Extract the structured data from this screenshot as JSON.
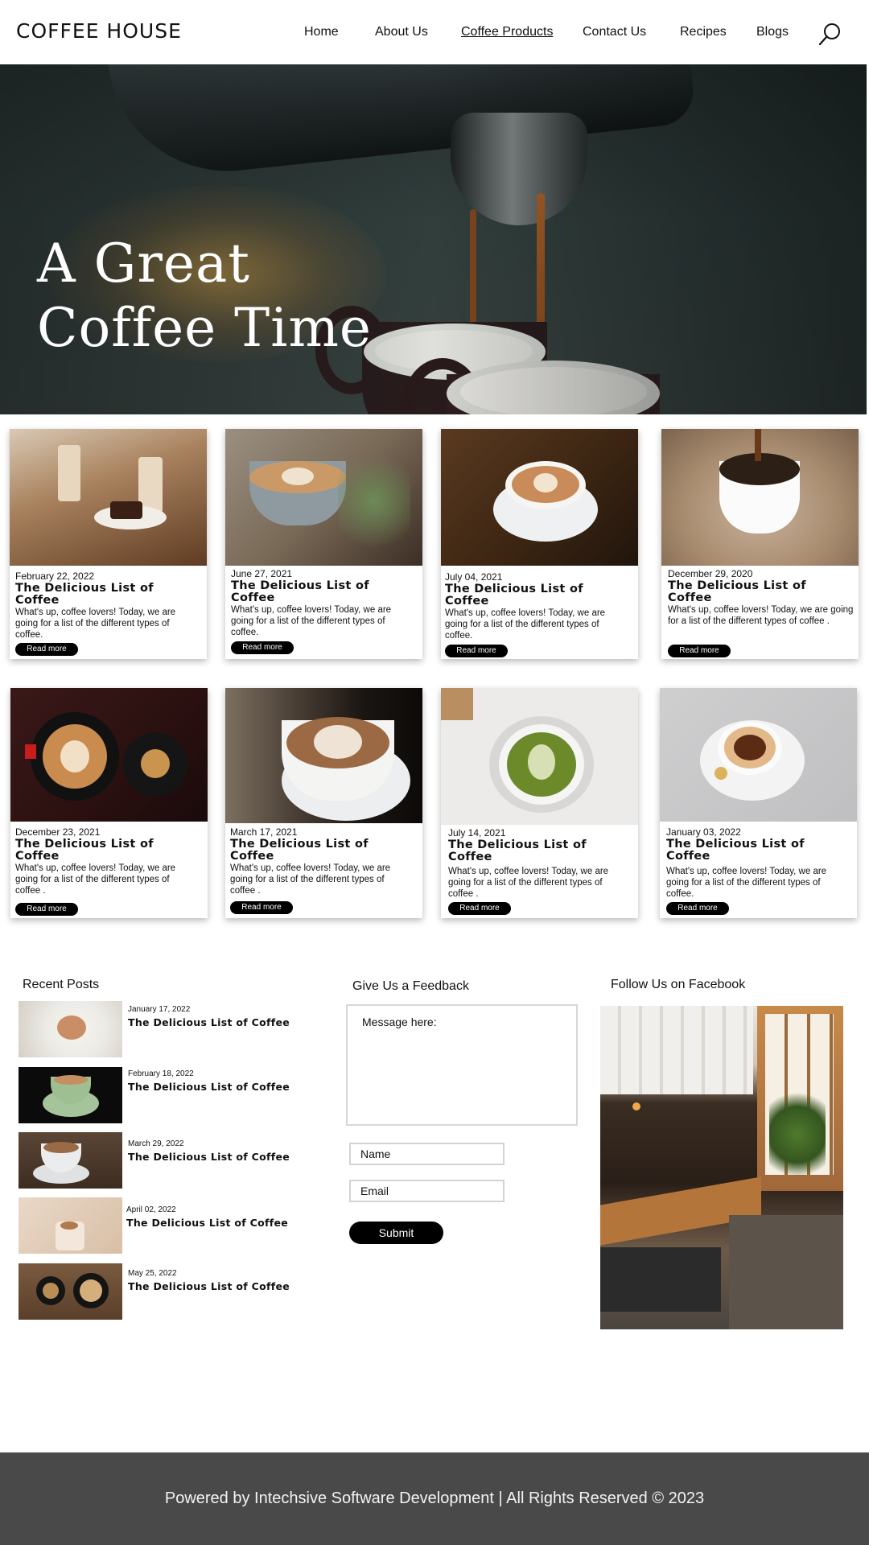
{
  "header": {
    "logo": "COFFEE HOUSE",
    "nav": [
      {
        "label": "Home"
      },
      {
        "label": "About Us"
      },
      {
        "label": "Coffee Products",
        "active": true
      },
      {
        "label": "Contact Us"
      },
      {
        "label": "Recipes"
      },
      {
        "label": "Blogs"
      }
    ],
    "search_icon": "search-icon"
  },
  "hero": {
    "title_line1": "A Great",
    "title_line2": "Coffee Time"
  },
  "cards": [
    {
      "date": "February 22, 2022",
      "title": "The Delicious List of Coffee",
      "text": "What's up, coffee lovers! Today, we are going for a list of the different types of coffee.",
      "button": "Read more"
    },
    {
      "date": "June 27, 2021",
      "title": "The Delicious List of Coffee",
      "text": "What's up, coffee lovers! Today, we are going for a list of the different types of coffee.",
      "button": "Read more"
    },
    {
      "date": "July 04, 2021",
      "title": "The Delicious List of Coffee",
      "text": "What's up, coffee lovers! Today, we are going for a list of the different types of coffee.",
      "button": "Read more"
    },
    {
      "date": "December 29, 2020",
      "title": "The Delicious List of Coffee",
      "text": "What's up, coffee lovers! Today, we are going for a list of the different types of coffee .",
      "button": "Read more"
    },
    {
      "date": "December 23, 2021",
      "title": "The Delicious List of Coffee",
      "text": "What's up, coffee  lovers! Today, we are going for a list of the different types of coffee .",
      "button": "Read more"
    },
    {
      "date": "March 17, 2021",
      "title": "The Delicious List of Coffee",
      "text": "What's up, coffee  lovers! Today, we are going for a list of the different types of coffee .",
      "button": "Read more"
    },
    {
      "date": "July 14, 2021",
      "title": "The Delicious List of Coffee",
      "text": "What's up, coffee  lovers! Today, we are going for a list of the different types of coffee .",
      "button": "Read more"
    },
    {
      "date": "January 03, 2022",
      "title": "The Delicious List of Coffee",
      "text": "What's up, coffee  lovers! Today, we are going for a list of the different types of coffee.",
      "button": "Read more"
    }
  ],
  "recent_posts": {
    "heading": "Recent Posts",
    "items": [
      {
        "date": "January 17, 2022",
        "title": "The Delicious List of Coffee"
      },
      {
        "date": "February 18, 2022",
        "title": "The Delicious List of Coffee"
      },
      {
        "date": "March 29, 2022",
        "title": "The Delicious List of Coffee"
      },
      {
        "date": "April 02, 2022",
        "title": "The Delicious List of Coffee"
      },
      {
        "date": "May 25, 2022",
        "title": "The Delicious List of Coffee"
      }
    ]
  },
  "feedback": {
    "heading": "Give Us a Feedback",
    "message_placeholder": "Message here:",
    "name_placeholder": "Name",
    "email_placeholder": "Email",
    "submit_label": "Submit"
  },
  "facebook": {
    "heading": "Follow Us on Facebook"
  },
  "footer": {
    "text": "Powered by Intechsive Software Development | All Rights Reserved © 2023"
  },
  "colors": {
    "footer_bg": "#494949",
    "button_bg": "#000000"
  }
}
